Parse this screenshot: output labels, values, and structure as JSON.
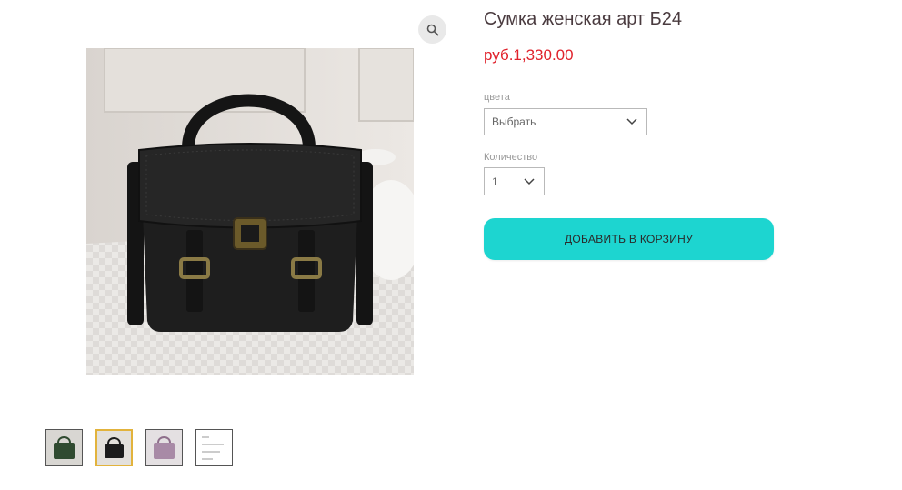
{
  "product": {
    "title": "Сумка женская арт Б24",
    "price": "руб.1,330.00"
  },
  "options": {
    "color_label": "цвета",
    "color_value": "Выбрать",
    "quantity_label": "Количество",
    "quantity_value": "1"
  },
  "actions": {
    "add_to_cart": "ДОБАВИТЬ В КОРЗИНУ"
  },
  "gallery": {
    "thumbnails": [
      {
        "name": "green-bag",
        "color": "#3c5a3e"
      },
      {
        "name": "black-bag",
        "color": "#1c1c1c",
        "active": true
      },
      {
        "name": "purple-bag",
        "color": "#a88aa6"
      },
      {
        "name": "size-chart"
      }
    ]
  },
  "colors": {
    "price": "#e0212b",
    "button": "#1dd5d0",
    "active_thumb_border": "#e2b33c"
  },
  "icons": {
    "zoom": "magnifier-icon",
    "dropdown": "chevron-down-icon"
  }
}
